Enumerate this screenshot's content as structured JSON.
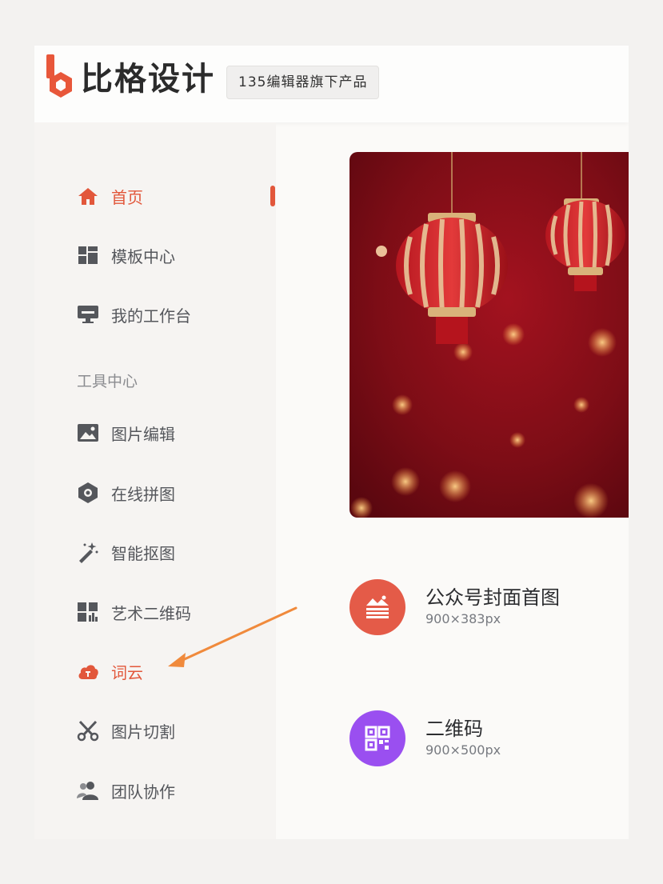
{
  "header": {
    "brand_name": "比格设计",
    "badge": "135编辑器旗下产品"
  },
  "sidebar": {
    "items": [
      {
        "label": "首页",
        "icon": "home-icon",
        "active": true
      },
      {
        "label": "模板中心",
        "icon": "template-grid-icon"
      },
      {
        "label": "我的工作台",
        "icon": "monitor-icon"
      }
    ],
    "section_title": "工具中心",
    "tools": [
      {
        "label": "图片编辑",
        "icon": "image-icon"
      },
      {
        "label": "在线拼图",
        "icon": "collage-icon"
      },
      {
        "label": "智能抠图",
        "icon": "magic-wand-icon"
      },
      {
        "label": "艺术二维码",
        "icon": "qr-art-icon"
      },
      {
        "label": "词云",
        "icon": "word-cloud-icon",
        "highlighted": true
      },
      {
        "label": "图片切割",
        "icon": "scissors-icon"
      },
      {
        "label": "团队协作",
        "icon": "team-icon"
      }
    ]
  },
  "main": {
    "banner_alt": "red lanterns banner",
    "cards": [
      {
        "title": "公众号封面首图",
        "size": "900×383px",
        "icon": "cover-image-icon",
        "color": "#e45b48"
      },
      {
        "title": "二维码",
        "size": "900×500px",
        "icon": "qr-code-icon",
        "color": "#9a4ff0"
      }
    ]
  },
  "colors": {
    "accent": "#e2573b",
    "annotation_arrow": "#f08a3c"
  }
}
